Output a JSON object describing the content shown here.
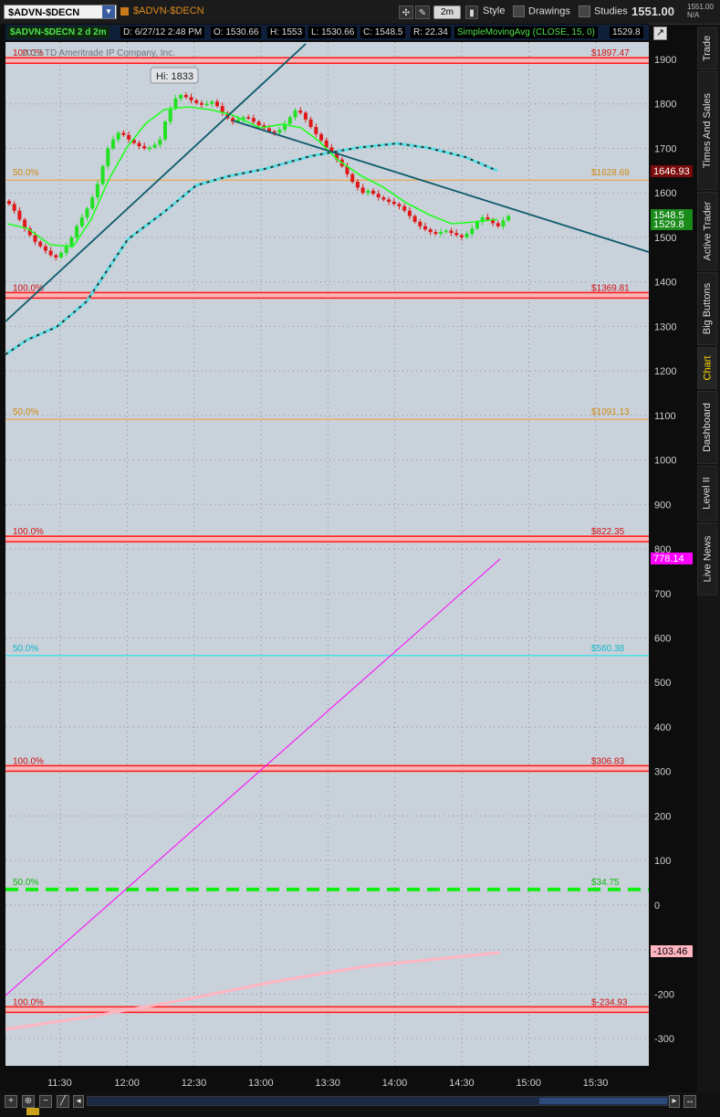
{
  "toolbar": {
    "symbol": "$ADVN-$DECN",
    "symbol_label": "$ADVN-$DECN",
    "aggregation": "2m",
    "style_label": "Style",
    "drawings_label": "Drawings",
    "studies_label": "Studies",
    "last_price": "1551.00",
    "mini_price": "1551.00",
    "mini_change": "N/A"
  },
  "info_bar": {
    "title": "$ADVN-$DECN 2 d 2m",
    "date": "D: 6/27/12 2:48 PM",
    "open": "O: 1530.66",
    "high": "H: 1553",
    "low": "L: 1530.66",
    "close": "C: 1548.5",
    "range": "R: 22.34",
    "study": "SimpleMovingAvg (CLOSE, 15, 0)",
    "study_value": "1529.8"
  },
  "side_tabs": [
    "Trade",
    "Times And Sales",
    "Active Trader",
    "Big Buttons",
    "Chart",
    "Dashboard",
    "Level II",
    "Live News"
  ],
  "active_tab": "Chart",
  "chart": {
    "copyright": "2012 TD Ameritrade IP Company, Inc.",
    "hi_bubble": "Hi: 1833",
    "y_ticks": [
      "1900",
      "1800",
      "1700",
      "1600",
      "1500",
      "1400",
      "1300",
      "1200",
      "1100",
      "1000",
      "900",
      "800",
      "700",
      "600",
      "500",
      "400",
      "300",
      "200",
      "100",
      "0",
      "-100",
      "-200",
      "-300"
    ],
    "x_ticks": [
      "11:30",
      "12:00",
      "12:30",
      "13:00",
      "13:30",
      "14:00",
      "14:30",
      "15:00",
      "15:30"
    ],
    "price_badges": [
      {
        "text": "1646.93",
        "bg": "#7a0c0c",
        "fg": "#ffffff"
      },
      {
        "text": "1548.5",
        "bg": "#1a8a1a",
        "fg": "#ffffff"
      },
      {
        "text": "1529.8",
        "bg": "#1a8a1a",
        "fg": "#ffffff"
      },
      {
        "text": "778.14",
        "bg": "#ff00ff",
        "fg": "#ffffff"
      },
      {
        "text": "-103.46",
        "bg": "#ffb6c1",
        "fg": "#000000"
      }
    ],
    "fib_left_labels": [
      "100.0%",
      "50.0%",
      "100.0%",
      "50.0%",
      "100.0%",
      "50.0%",
      "100.0%",
      "50.0%",
      "100.0%"
    ],
    "fib_right_labels": [
      "$1897.47",
      "$1628.69",
      "$1369.81",
      "$1091.13",
      "$822.35",
      "$560.38",
      "$306.83",
      "$34.75",
      "$-234.93"
    ],
    "colors": {
      "background": "#c9d1da",
      "up_candle": "#22e022",
      "down_candle": "#e01818",
      "sma": "#22ff22",
      "trend_line": "#0b5a6a",
      "fib_red": "#ff1a1a",
      "fib_orange": "#f0a030",
      "fib_cyan": "#22e6e6",
      "fib_green": "#11ee11",
      "magenta": "#ff00ff",
      "pink": "#ffb6c1"
    }
  }
}
